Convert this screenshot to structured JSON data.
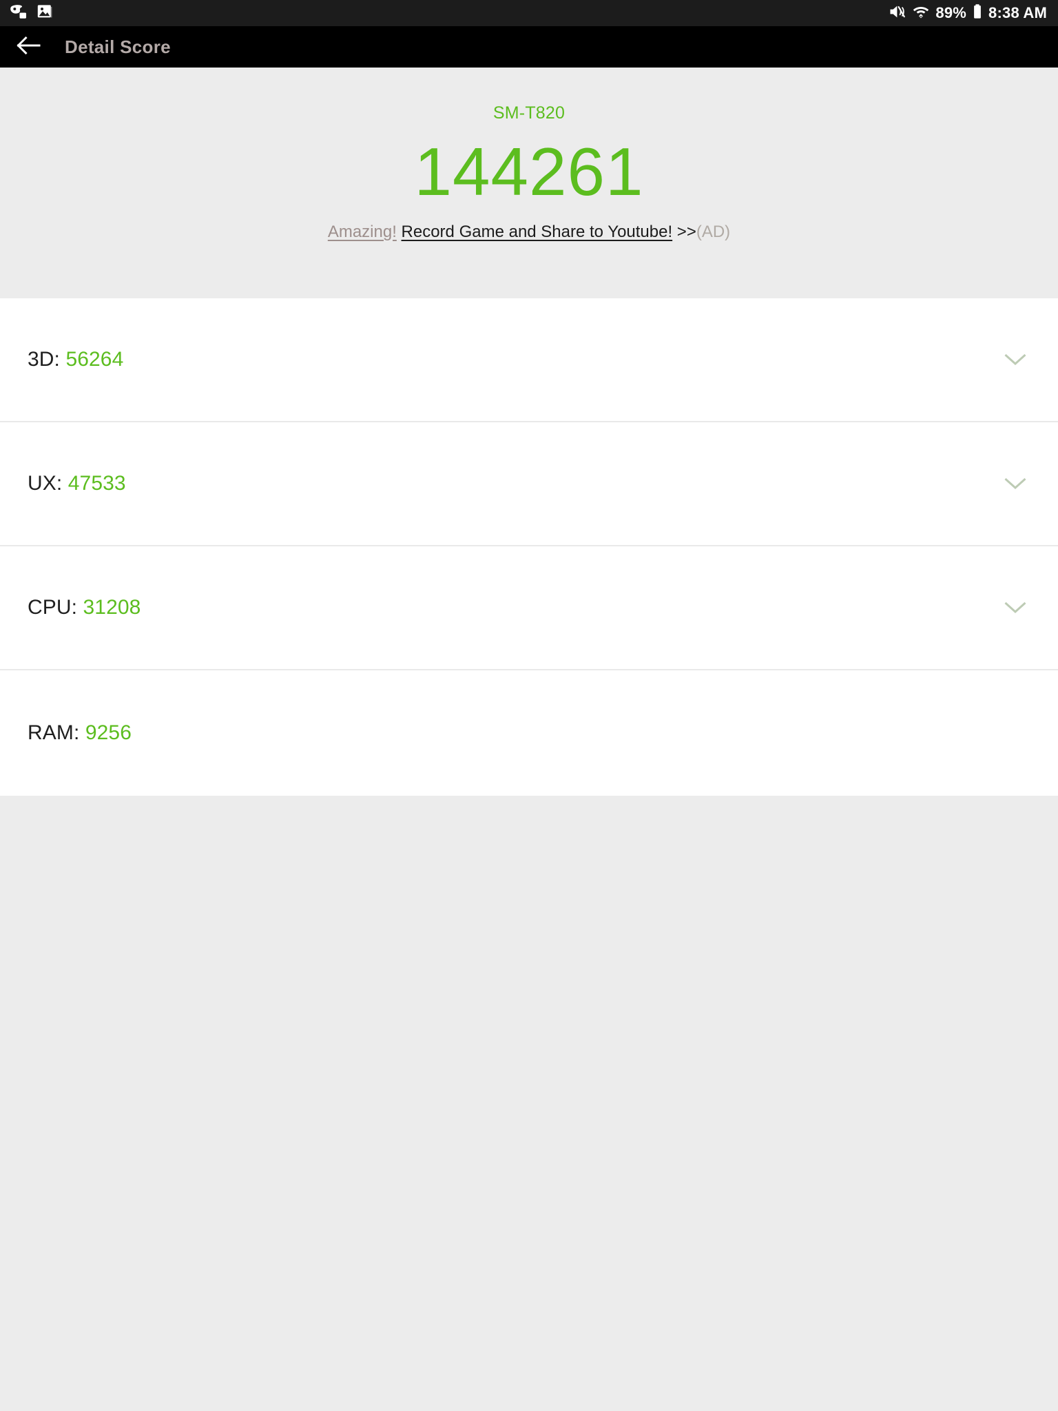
{
  "status_bar": {
    "left_icons": [
      {
        "name": "game-tools-icon",
        "label": "Game Tools"
      },
      {
        "name": "screenshot-image-icon",
        "label": "Screenshot"
      }
    ],
    "mute_icon": "volume-mute-icon",
    "wifi_icon": "wifi-icon",
    "battery_percent": "89%",
    "battery_icon": "battery-icon",
    "time": "8:38 AM",
    "background_color": "#1c1c1c",
    "text_color": "#ffffff"
  },
  "app_bar": {
    "back_icon": "back-arrow-icon",
    "title": "Detail Score",
    "background_color": "#000000",
    "title_color": "#b4aaa8"
  },
  "score_header": {
    "device_name": "SM-T820",
    "total_score": "144261",
    "accent_color": "#5cbd1f",
    "background_color": "#ececec",
    "ad": {
      "amazing": "Amazing!",
      "link_text": "Record Game and Share to Youtube!",
      "arrows": " >>",
      "tag": "(AD)"
    }
  },
  "detail_list": {
    "rows": [
      {
        "label": "3D:",
        "value": "56264",
        "expandable": true,
        "chevron": "chevron-down-icon"
      },
      {
        "label": "UX:",
        "value": "47533",
        "expandable": true,
        "chevron": "chevron-down-icon"
      },
      {
        "label": "CPU:",
        "value": "31208",
        "expandable": true,
        "chevron": "chevron-down-icon"
      },
      {
        "label": "RAM:",
        "value": "9256",
        "expandable": false,
        "chevron": ""
      }
    ],
    "value_color": "#5cbd1f",
    "label_color": "#1f1f1f",
    "separator_color": "#e9e9e9"
  }
}
